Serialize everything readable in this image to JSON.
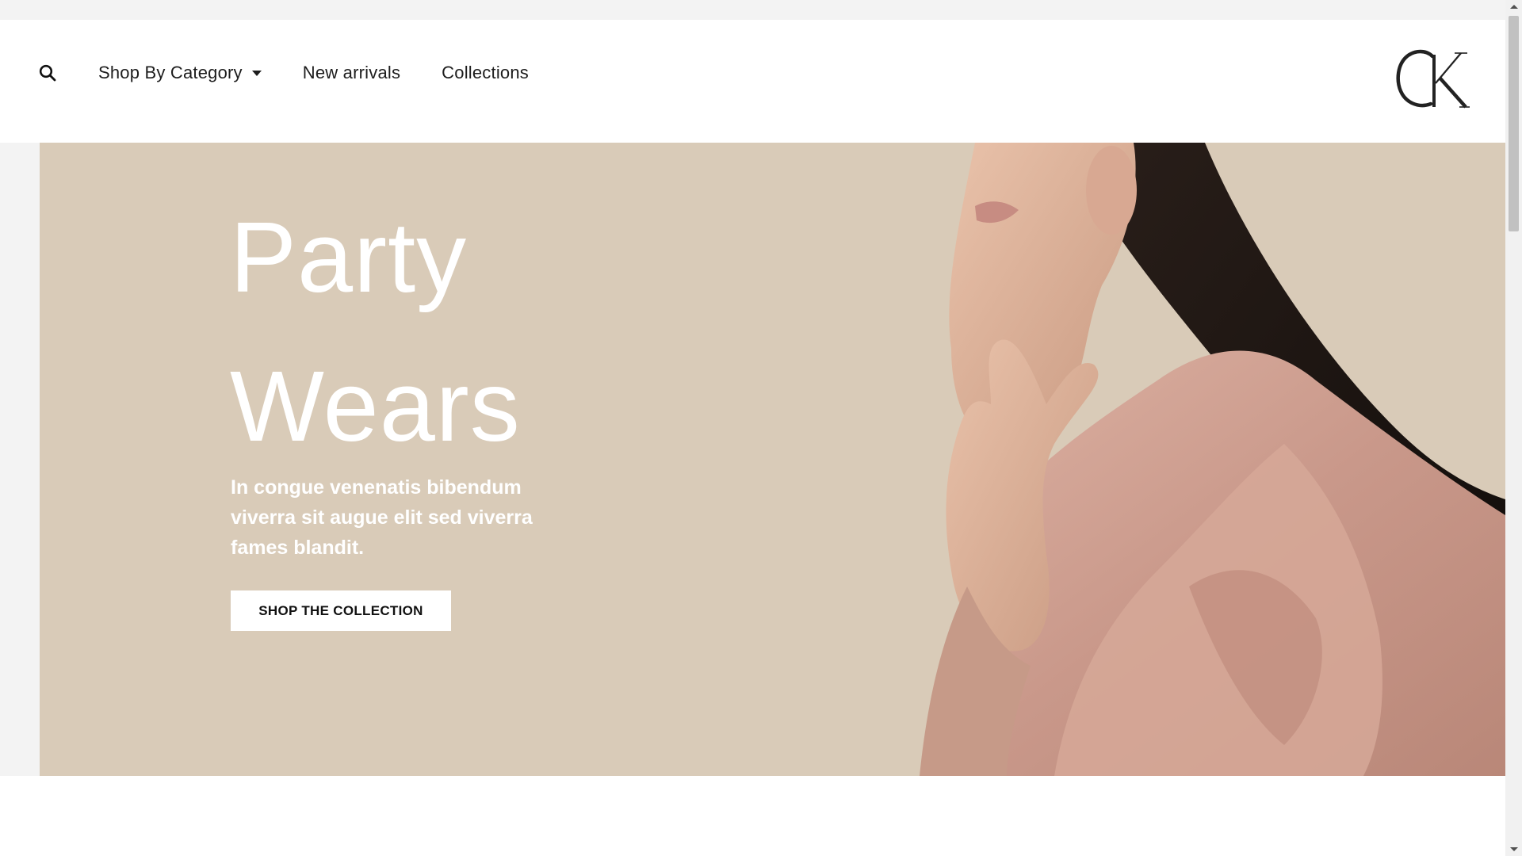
{
  "header": {
    "search_icon": "search-icon",
    "nav": [
      {
        "label": "Shop By Category",
        "has_dropdown": true
      },
      {
        "label": "New arrivals",
        "has_dropdown": false
      },
      {
        "label": "Collections",
        "has_dropdown": false
      }
    ],
    "logo_text": "CK"
  },
  "hero": {
    "title_line1": "Party",
    "title_line2": "Wears",
    "description": "In congue venenatis bibendum viverra sit augue elit sed viverra fames blandit.",
    "cta_label": "SHOP THE COLLECTION",
    "image": "woman-in-pink-blouse-photo"
  },
  "colors": {
    "hero_background": "#d9cbb8",
    "header_background": "#ffffff",
    "page_background": "#f3f3f3",
    "text_dark": "#1d1d1d"
  }
}
